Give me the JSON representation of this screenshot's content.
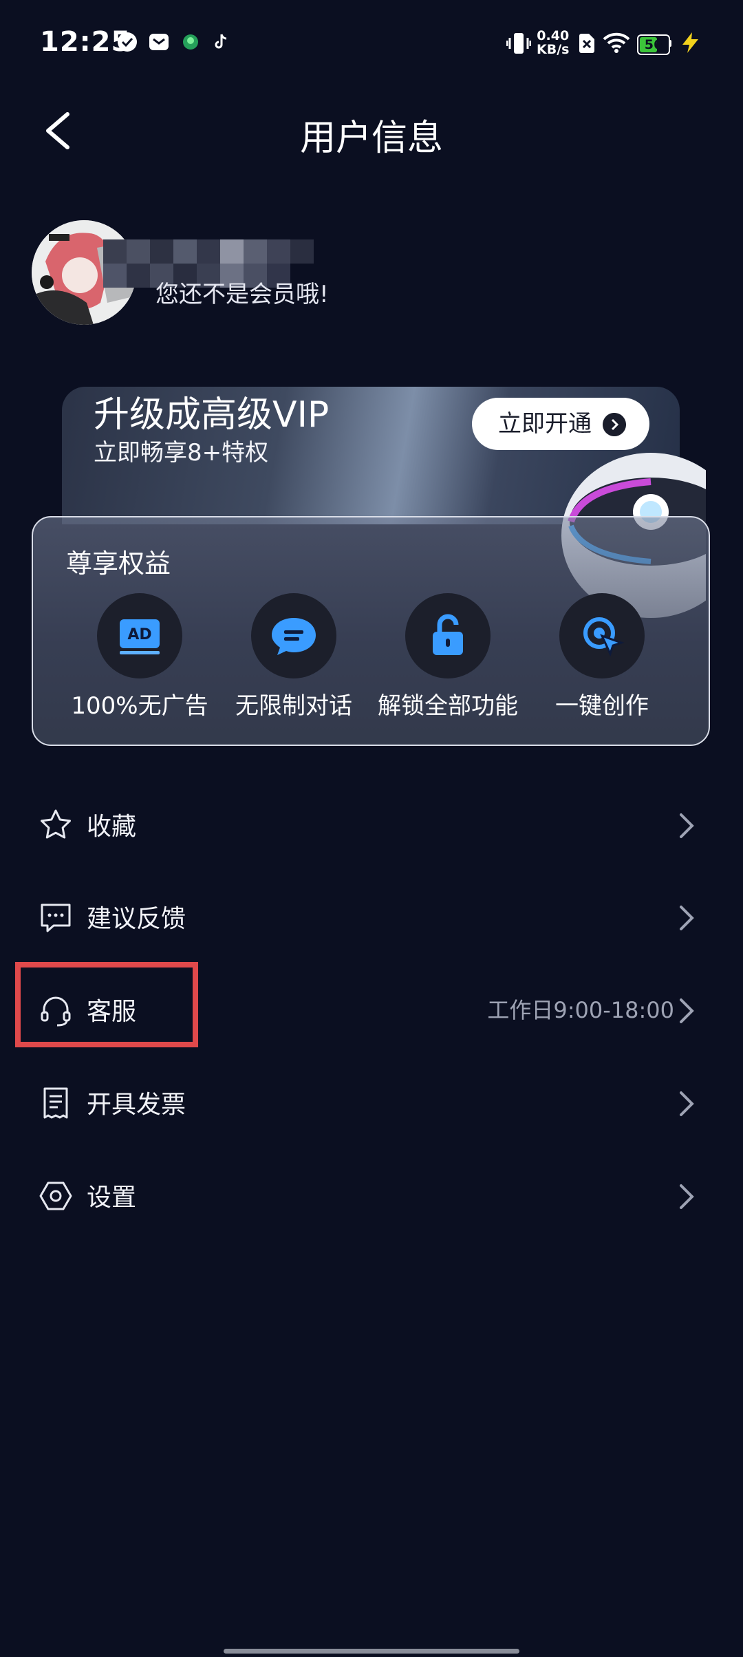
{
  "status_bar": {
    "time": "12:25",
    "net_speed_value": "0.40",
    "net_speed_unit": "KB/s",
    "battery": "56",
    "icons": [
      "check-circle-icon",
      "message-icon",
      "app-icon",
      "tiktok-icon",
      "vibrate-icon",
      "sim-off-icon",
      "wifi-icon",
      "battery-icon",
      "charging-icon"
    ]
  },
  "header": {
    "title": "用户信息"
  },
  "profile": {
    "subtitle": "您还不是会员哦!"
  },
  "vip": {
    "title": "升级成高级VIP",
    "subtitle": "立即畅享8+特权",
    "button_label": "立即开通"
  },
  "benefits": {
    "title": "尊享权益",
    "items": [
      {
        "label": "100%无广告",
        "icon": "ad-free-icon"
      },
      {
        "label": "无限制对话",
        "icon": "chat-icon"
      },
      {
        "label": "解锁全部功能",
        "icon": "unlock-icon"
      },
      {
        "label": "一键创作",
        "icon": "create-icon"
      }
    ]
  },
  "menu": {
    "items": [
      {
        "label": "收藏",
        "icon": "star-icon",
        "right": ""
      },
      {
        "label": "建议反馈",
        "icon": "feedback-icon",
        "right": ""
      },
      {
        "label": "客服",
        "icon": "headset-icon",
        "right": "工作日9:00-18:00"
      },
      {
        "label": "开具发票",
        "icon": "invoice-icon",
        "right": ""
      },
      {
        "label": "设置",
        "icon": "settings-icon",
        "right": ""
      }
    ]
  },
  "colors": {
    "background": "#0b0f21",
    "highlight": "#e0494b",
    "accent": "#3b82f6"
  }
}
